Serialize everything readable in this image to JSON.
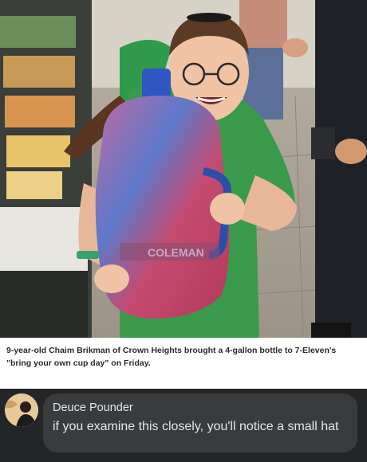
{
  "post": {
    "photo_description_icon": "photo-image",
    "caption": "9-year-old Chaim Brikman of Crown Heights brought a 4-gallon bottle to 7-Eleven's \"bring your own cup day\" on Friday.",
    "bottle_label": "COLEMAN"
  },
  "comment": {
    "author": "Deuce Pounder",
    "text": "if you examine this closely, you'll notice a small hat"
  },
  "colors": {
    "comment_background": "#242526",
    "comment_bubble": "#3a3b3c",
    "comment_text": "#e4e6eb",
    "caption_text": "#2a2a2a"
  }
}
